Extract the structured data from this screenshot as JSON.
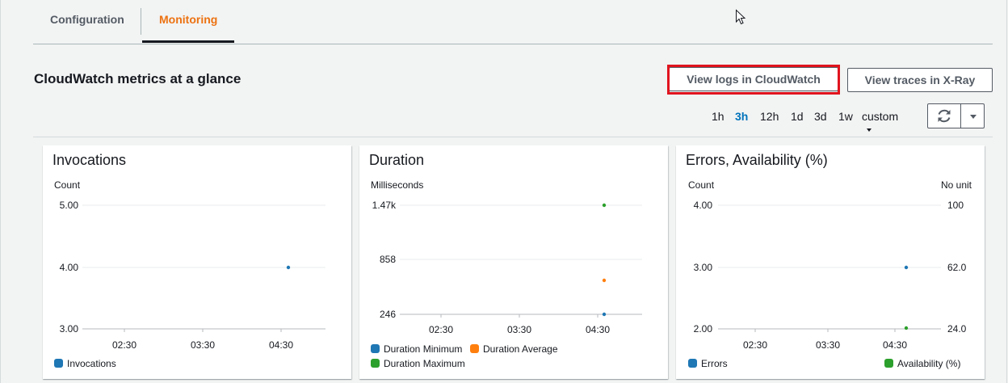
{
  "tabs": {
    "configuration": "Configuration",
    "monitoring": "Monitoring"
  },
  "section_title": "CloudWatch metrics at a glance",
  "buttons": {
    "view_logs": "View logs in CloudWatch",
    "view_traces": "View traces in X-Ray"
  },
  "time_ranges": [
    "1h",
    "3h",
    "12h",
    "1d",
    "3d",
    "1w",
    "custom"
  ],
  "time_range_active": "3h",
  "icons": {
    "refresh": "refresh-icon",
    "dropdown": "caret-down-icon"
  },
  "colors": {
    "accent": "#ec7211",
    "link": "#0073bb",
    "blue": "#1f77b4",
    "orange": "#ff7f0e",
    "green": "#2ca02c",
    "highlight": "#e0141e"
  },
  "chart_data": [
    {
      "type": "scatter",
      "title": "Invocations",
      "ylabel": "Count",
      "ylim": [
        3.0,
        5.0
      ],
      "y_ticks": [
        "5.00",
        "4.00",
        "3.00"
      ],
      "x_ticks": [
        "02:30",
        "03:30",
        "04:30"
      ],
      "series": [
        {
          "name": "Invocations",
          "points": [
            {
              "x": "04:37",
              "y": 4.0
            }
          ]
        }
      ]
    },
    {
      "type": "scatter",
      "title": "Duration",
      "ylabel": "Milliseconds",
      "ylim": [
        246,
        1470
      ],
      "y_ticks": [
        "1.47k",
        "858",
        "246"
      ],
      "x_ticks": [
        "02:30",
        "03:30",
        "04:30"
      ],
      "series": [
        {
          "name": "Duration Minimum",
          "points": [
            {
              "x": "04:35",
              "y": 246
            }
          ]
        },
        {
          "name": "Duration Average",
          "points": [
            {
              "x": "04:35",
              "y": 660
            }
          ]
        },
        {
          "name": "Duration Maximum",
          "points": [
            {
              "x": "04:35",
              "y": 1470
            }
          ]
        }
      ]
    },
    {
      "type": "scatter",
      "title": "Errors, Availability (%)",
      "ylabel": "Count",
      "y2label": "No unit",
      "ylim": [
        2.0,
        4.0
      ],
      "y2lim": [
        24.0,
        100
      ],
      "y_ticks": [
        "4.00",
        "3.00",
        "2.00"
      ],
      "y2_ticks": [
        "100",
        "62.0",
        "24.0"
      ],
      "x_ticks": [
        "02:30",
        "03:30",
        "04:30"
      ],
      "series": [
        {
          "name": "Errors",
          "axis": "left",
          "points": [
            {
              "x": "04:40",
              "y": 3.0
            }
          ]
        },
        {
          "name": "Availability (%)",
          "axis": "right",
          "points": [
            {
              "x": "04:40",
              "y": 24.0
            }
          ]
        }
      ]
    }
  ]
}
